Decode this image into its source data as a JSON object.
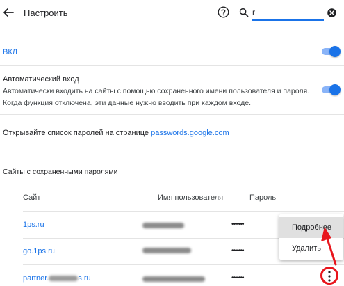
{
  "header": {
    "title": "Настроить",
    "back_icon": "arrow-back-icon",
    "help_icon": "help-icon",
    "search": {
      "value": "г",
      "icon": "search-icon",
      "clear_icon": "clear-icon"
    }
  },
  "offer_save": {
    "label": "ВКЛ",
    "enabled": true
  },
  "auto_signin": {
    "title": "Автоматический вход",
    "desc_line1": "Автоматически входить на сайты с помощью сохраненного имени пользователя и пароля.",
    "desc_line2": "Когда функция отключена, эти данные нужно вводить при каждом входе.",
    "enabled": true
  },
  "open_list": {
    "text": "Открывайте список паролей на странице ",
    "link": "passwords.google.com"
  },
  "saved": {
    "title": "Сайты с сохраненными паролями",
    "columns": {
      "site": "Сайт",
      "username": "Имя пользователя",
      "password": "Пароль"
    },
    "rows": [
      {
        "site": "1ps.ru",
        "password": "•••••••"
      },
      {
        "site": "go.1ps.ru",
        "password": "•••••••"
      },
      {
        "site_prefix": "partner.",
        "site_suffix": "s.ru",
        "password": "•••••••"
      }
    ]
  },
  "context_menu": {
    "items": [
      "Подробнее",
      "Удалить"
    ],
    "highlighted": "Подробнее"
  },
  "colors": {
    "accent": "#1a73e8",
    "annotation": "#e8151c"
  }
}
